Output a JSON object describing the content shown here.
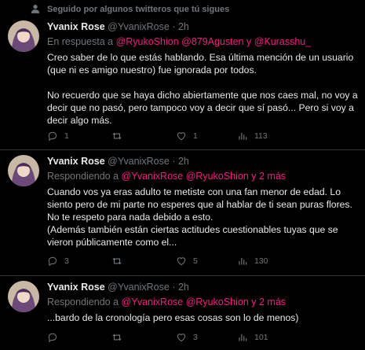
{
  "social_context": {
    "icon": "person-icon",
    "text": "Seguido por algunos twitteros que tú sigues"
  },
  "tweets": [
    {
      "name": "Yvanix Rose",
      "handle": "@YvanixRose",
      "dot": "·",
      "time": "2h",
      "reply_prefix": "En respuesta a",
      "reply_targets": "@RyukoShion @879Agusten y @Kurasshu_",
      "paragraphs": [
        "Creo saber de lo que estás hablando. Esa última mención de un usuario (que ni es amigo nuestro) fue ignorada por todos.",
        "No recuerdo que se haya dicho abiertamente que nos caes mal, no voy a decir que no pasó, pero tampoco voy a decir que sí pasó... Pero si voy a decir algo más."
      ],
      "stats": {
        "replies": "1",
        "retweets": "",
        "likes": "1",
        "views": "113"
      }
    },
    {
      "name": "Yvanix Rose",
      "handle": "@YvanixRose",
      "dot": "·",
      "time": "2h",
      "reply_prefix": "Respondiendo a",
      "reply_targets": "@YvanixRose @RyukoShion y 2 más",
      "paragraphs": [
        "Cuando vos ya eras adulto te metiste con una fan menor de edad. Lo siento pero de mi parte no esperes que al hablar de ti sean puras flores. No te respeto para nada debido a esto.\n(Además también están ciertas actitudes cuestionables tuyas que se vieron públicamente como el..."
      ],
      "stats": {
        "replies": "3",
        "retweets": "",
        "likes": "5",
        "views": "130"
      }
    },
    {
      "name": "Yvanix Rose",
      "handle": "@YvanixRose",
      "dot": "·",
      "time": "2h",
      "reply_prefix": "Respondiendo a",
      "reply_targets": "@YvanixRose @RyukoShion y 2 más",
      "paragraphs": [
        "...bardo de la cronología pero esas cosas son lo de menos)"
      ],
      "stats": {
        "replies": "",
        "retweets": "",
        "likes": "3",
        "views": "101"
      }
    }
  ],
  "colors": {
    "background": "#000000",
    "text": "#e7e9ea",
    "muted": "#71767b",
    "mention": "#f91880",
    "divider": "#2f3336"
  },
  "icons": {
    "reply": "reply-icon",
    "retweet": "retweet-icon",
    "like": "heart-icon",
    "views": "views-icon"
  }
}
